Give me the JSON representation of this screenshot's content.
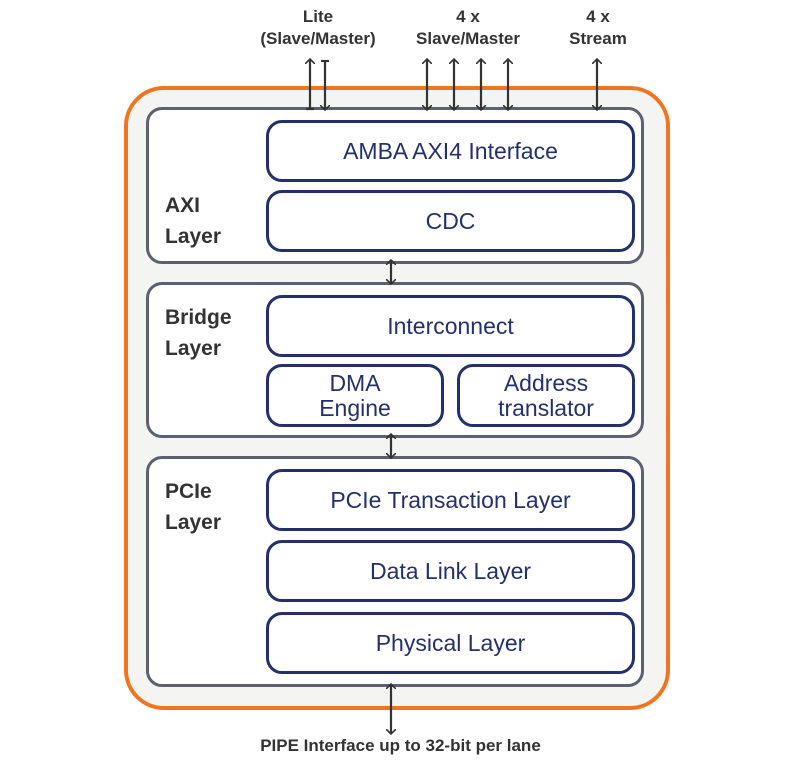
{
  "top_interfaces": [
    {
      "line1": "Lite",
      "line2": "(Slave/Master)"
    },
    {
      "line1": "4 x",
      "line2": "Slave/Master"
    },
    {
      "line1": "4 x",
      "line2": "Stream"
    }
  ],
  "layers": {
    "axi": {
      "title_line1": "AXI",
      "title_line2": "Layer",
      "blocks": [
        "AMBA AXI4 Interface",
        "CDC"
      ]
    },
    "bridge": {
      "title_line1": "Bridge",
      "title_line2": "Layer",
      "blocks": [
        "Interconnect"
      ],
      "dma": {
        "line1": "DMA",
        "line2": "Engine"
      },
      "address": {
        "line1": "Address",
        "line2": "translator"
      }
    },
    "pcie": {
      "title_line1": "PCIe",
      "title_line2": "Layer",
      "blocks": [
        "PCIe Transaction Layer",
        "Data Link Layer",
        "Physical Layer"
      ]
    }
  },
  "bottom_interface": "PIPE Interface up to 32-bit per lane",
  "colors": {
    "outer_border": "#ee7623",
    "layer_border": "#5d606e",
    "block_border": "#25306a",
    "text_dark": "#333333"
  }
}
